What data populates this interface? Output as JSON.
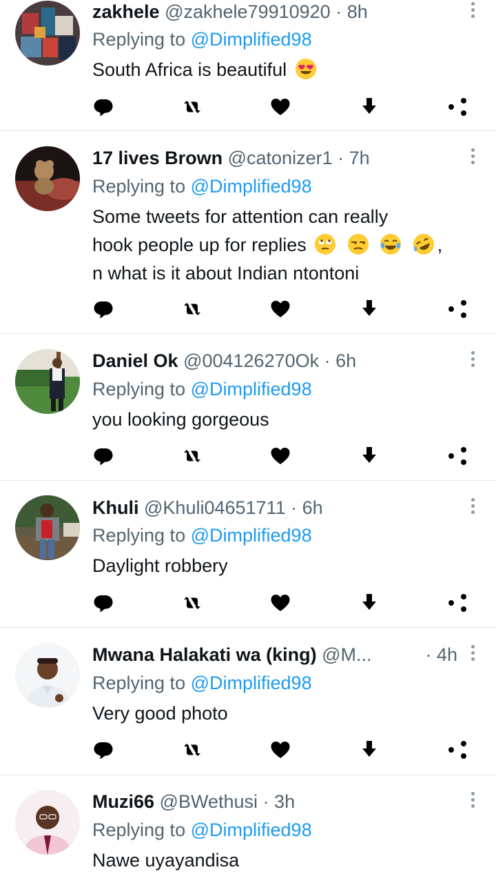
{
  "replying_label": "Replying to",
  "tweets": [
    {
      "name": "zakhele",
      "handle": "@zakhele79910920",
      "separator": "·",
      "time": "8h",
      "reply_to": "@Dimplified98",
      "text": "South Africa is beautiful",
      "emojis": [
        "heart-eyes-emoji"
      ]
    },
    {
      "name": "17 lives Brown",
      "handle": "@catonizer1",
      "separator": "·",
      "time": "7h",
      "reply_to": "@Dimplified98",
      "text_line1": "Some tweets for attention can really",
      "text_line2": "hook people up for replies",
      "text_line2_end": ",",
      "text_line3": "n what is it about Indian ntontoni",
      "emojis": [
        "eye-roll-emoji",
        "unamused-emoji",
        "tears-of-joy-emoji",
        "rolling-laughing-emoji"
      ]
    },
    {
      "name": "Daniel Ok",
      "handle": "@004126270Ok",
      "separator": "·",
      "time": "6h",
      "reply_to": "@Dimplified98",
      "text": "you looking gorgeous"
    },
    {
      "name": "Khuli",
      "handle": "@Khuli04651711",
      "separator": "·",
      "time": "6h",
      "reply_to": "@Dimplified98",
      "text": "Daylight robbery"
    },
    {
      "name": "Mwana Halakati wa (king)",
      "handle": "@M...",
      "separator": "·",
      "time": "4h",
      "reply_to": "@Dimplified98",
      "text": "Very good photo"
    },
    {
      "name": "Muzi66",
      "handle": "@BWethusi",
      "separator": "·",
      "time": "3h",
      "reply_to": "@Dimplified98",
      "text": "Nawe uyayandisa"
    }
  ],
  "icons": {
    "reply": "reply-icon",
    "retweet": "retweet-icon",
    "like": "like-icon",
    "download": "download-icon",
    "share": "share-icon",
    "more": "more-options-icon"
  },
  "colors": {
    "link": "#1d9bf0",
    "secondary_text": "#536471",
    "primary_text": "#0f1419",
    "divider": "#e1e6ea"
  }
}
